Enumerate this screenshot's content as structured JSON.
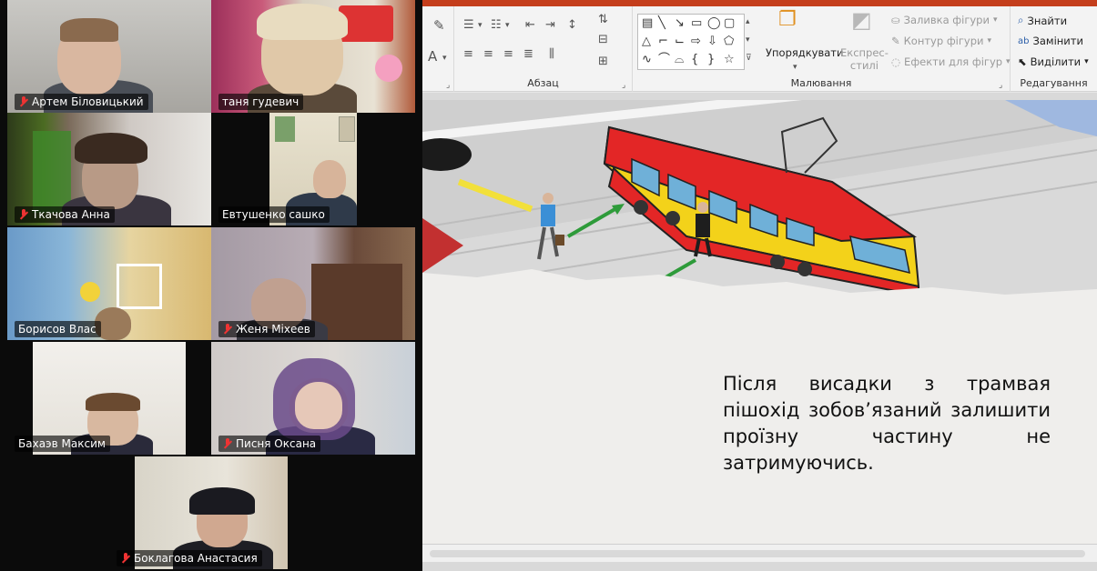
{
  "participants": [
    {
      "name": "Артем Біловицький",
      "muted": true
    },
    {
      "name": "таня гудевич",
      "muted": false
    },
    {
      "name": "Ткачова Анна",
      "muted": true,
      "active_speaker": true
    },
    {
      "name": "Евтушенко сашко",
      "muted": false
    },
    {
      "name": "Борисов Влас",
      "muted": false
    },
    {
      "name": "Женя Міхеев",
      "muted": true
    },
    {
      "name": "Бахаэв Максим",
      "muted": false
    },
    {
      "name": "Писня Оксана",
      "muted": true
    },
    {
      "name": "Боклагова Анастасия",
      "muted": true
    }
  ],
  "ribbon": {
    "paragraph_label": "Абзац",
    "drawing_label": "Малювання",
    "editing_label": "Редагування",
    "arrange_label": "Упорядкувати",
    "quick_styles_label": "Експрес-стилі",
    "shape_fill": "Заливка фігури",
    "shape_outline": "Контур фігури",
    "shape_effects": "Ефекти для фігур",
    "find": "Знайти",
    "replace": "Замінити",
    "select": "Виділити"
  },
  "slide": {
    "text": "Після висадки з трамвая пішохід зобов’язаний залишити проїзну частину не затримуючись."
  },
  "colors": {
    "accent": "#c43e1c",
    "speaker_border": "#3ad17a",
    "muted_icon": "#e33333",
    "tram_red": "#e32626",
    "tram_yellow": "#f3d21a"
  }
}
